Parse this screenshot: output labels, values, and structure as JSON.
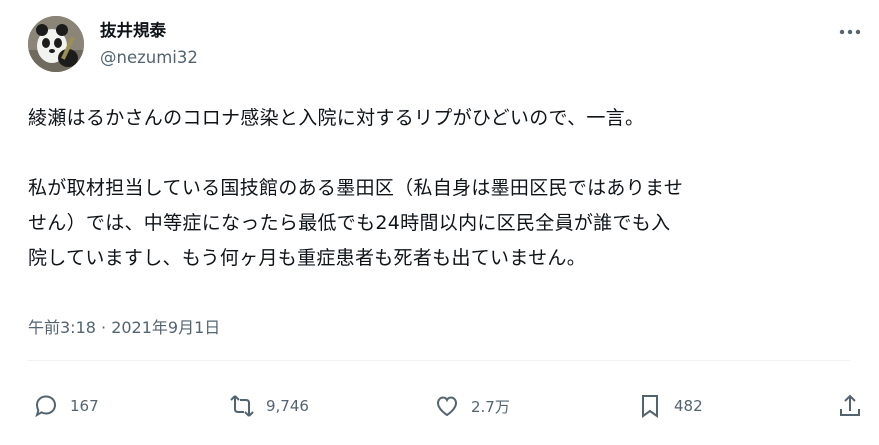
{
  "user": {
    "display_name": "抜井規泰",
    "handle": "@nezumi32"
  },
  "tweet": {
    "lines": [
      "綾瀬はるかさんのコロナ感染と入院に対するリプがひどいので、一言。",
      "私が取材担当している国技館のある墨田区（私自身は墨田区民ではありませ",
      "せん）では、中等症になったら最低でも24時間以内に区民全員が誰でも入",
      "院していますし、もう何ヶ月も重症患者も死者も出ていません。"
    ],
    "timestamp": "午前3:18 · 2021年9月1日"
  },
  "actions": {
    "reply_count": "167",
    "retweet_count": "9,746",
    "like_count": "2.7万",
    "bookmark_count": "482"
  }
}
